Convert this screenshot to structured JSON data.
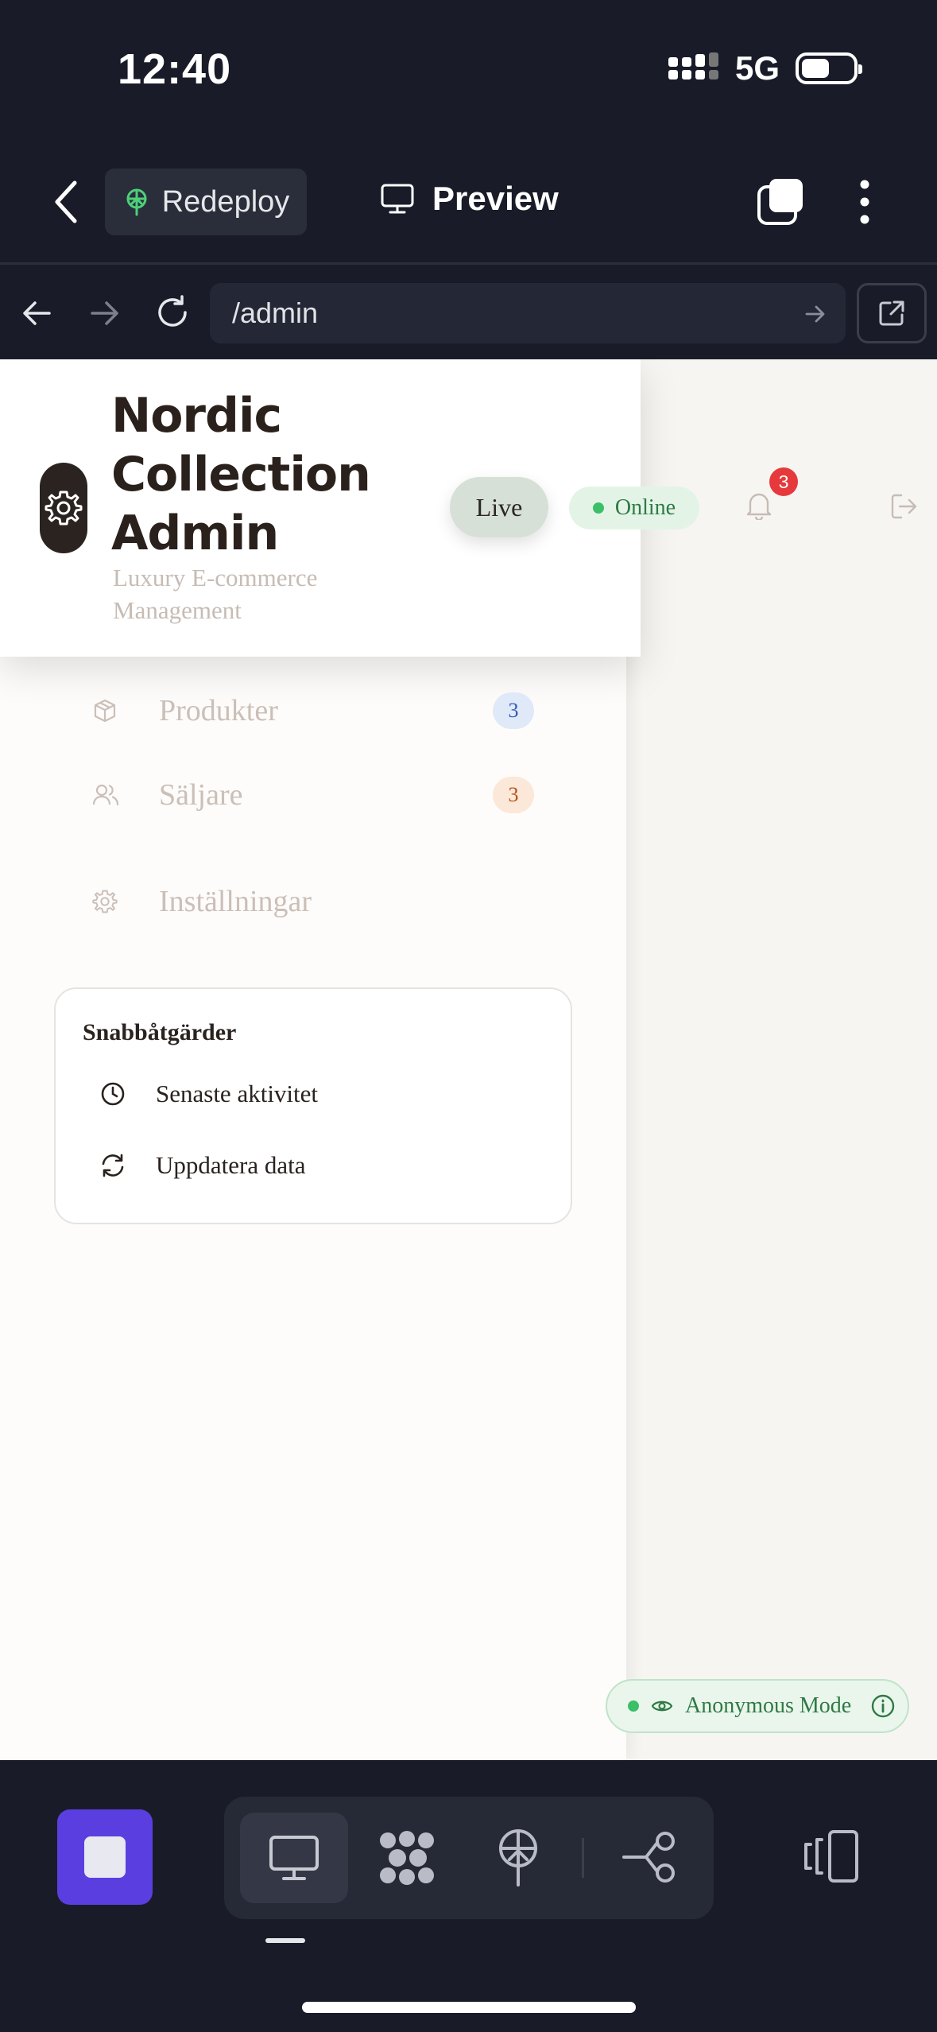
{
  "status_bar": {
    "time": "12:40",
    "network": "5G"
  },
  "app_bar": {
    "redeploy_label": "Redeploy",
    "preview_label": "Preview"
  },
  "browser": {
    "url": "/admin"
  },
  "brand": {
    "title": "Nordic Collection Admin",
    "subtitle": "Luxury E-commerce Management"
  },
  "header": {
    "live_label": "Live",
    "online_label": "Online",
    "notification_count": "3"
  },
  "nav": {
    "items": [
      {
        "label": "Produkter",
        "count": "3",
        "icon": "box-icon"
      },
      {
        "label": "Säljare",
        "count": "3",
        "icon": "users-icon"
      },
      {
        "label": "Inställningar",
        "icon": "gear-icon"
      }
    ]
  },
  "quick_actions": {
    "title": "Snabbåtgärder",
    "items": [
      {
        "label": "Senaste aktivitet",
        "icon": "clock-icon"
      },
      {
        "label": "Uppdatera data",
        "icon": "refresh-icon"
      }
    ]
  },
  "anonymous_mode": {
    "label": "Anonymous Mode"
  },
  "colors": {
    "accent": "#5b3ee0",
    "online": "#3bbf67",
    "badge_red": "#e5393b"
  }
}
